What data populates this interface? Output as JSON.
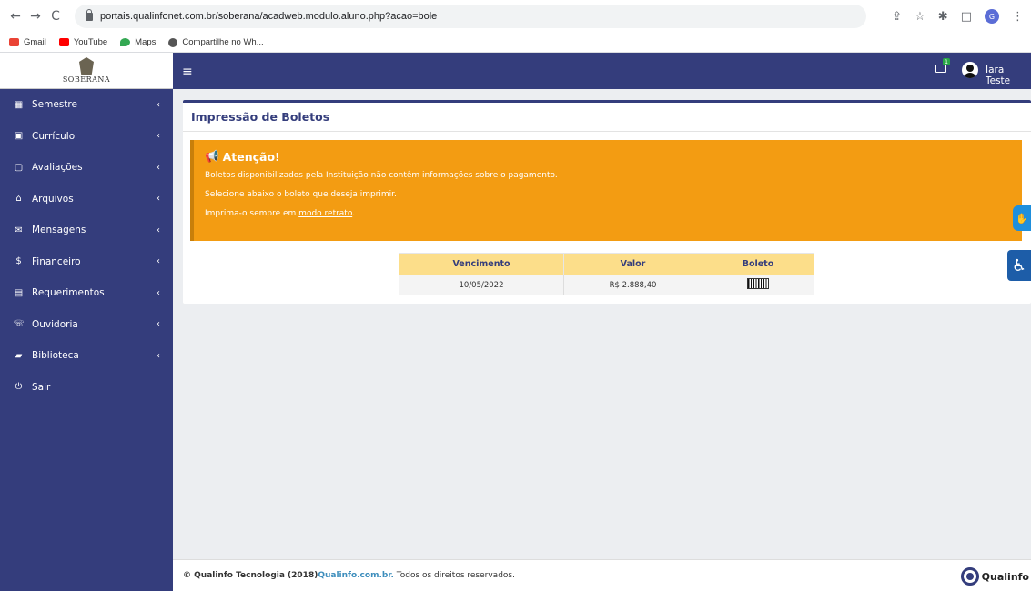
{
  "browser": {
    "back": "←",
    "forward": "→",
    "reload": "C",
    "url": "portais.qualinfonet.com.br/soberana/acadweb.modulo.aluno.php?acao=bole",
    "profile_initial": "G",
    "actions": [
      "⇪",
      "☆",
      "✱",
      "□"
    ],
    "bookmarks": [
      {
        "label": "Gmail",
        "color": "#ea4335"
      },
      {
        "label": "YouTube",
        "color": "#ff0000"
      },
      {
        "label": "Maps",
        "color": "#34a853"
      },
      {
        "label": "Compartilhe no Wh...",
        "color": "#555555"
      }
    ]
  },
  "logo": {
    "text": "SOBERANA"
  },
  "sidebar": {
    "items": [
      {
        "label": "Semestre",
        "icon": "▦",
        "chevron": "‹"
      },
      {
        "label": "Currículo",
        "icon": "▣",
        "chevron": "‹"
      },
      {
        "label": "Avaliações",
        "icon": "▢",
        "chevron": "‹"
      },
      {
        "label": "Arquivos",
        "icon": "⌂",
        "chevron": "‹"
      },
      {
        "label": "Mensagens",
        "icon": "✉",
        "chevron": "‹"
      },
      {
        "label": "Financeiro",
        "icon": "$",
        "chevron": "‹"
      },
      {
        "label": "Requerimentos",
        "icon": "▤",
        "chevron": "‹"
      },
      {
        "label": "Ouvidoria",
        "icon": "☏",
        "chevron": "‹"
      },
      {
        "label": "Biblioteca",
        "icon": "▰",
        "chevron": "‹"
      },
      {
        "label": "Sair",
        "icon": "⏻",
        "chevron": ""
      }
    ]
  },
  "topbar": {
    "menu_icon": "≡",
    "mail_badge": "1",
    "user_name": "Iara Teste"
  },
  "page": {
    "title": "Impressão de Boletos",
    "alert": {
      "title": "Atenção!",
      "line1": "Boletos disponibilizados pela Instituição não contêm informações sobre o pagamento.",
      "line2": "Selecione abaixo o boleto que deseja imprimir.",
      "line3_prefix": "Imprima-o sempre em ",
      "line3_link": "modo retrato",
      "line3_suffix": "."
    },
    "table": {
      "headers": [
        "Vencimento",
        "Valor",
        "Boleto"
      ],
      "rows": [
        {
          "vencimento": "10/05/2022",
          "valor": "R$ 2.888,40"
        }
      ]
    }
  },
  "footer": {
    "prefix": "© Qualinfo Tecnologia (2018)",
    "link": "Qualinfo.com.br.",
    "suffix": " Todos os direitos reservados.",
    "brand": "Qualinfo"
  },
  "colors": {
    "primary": "#343d7c",
    "alert": "#f39c12",
    "table_header": "#fcde8a"
  }
}
